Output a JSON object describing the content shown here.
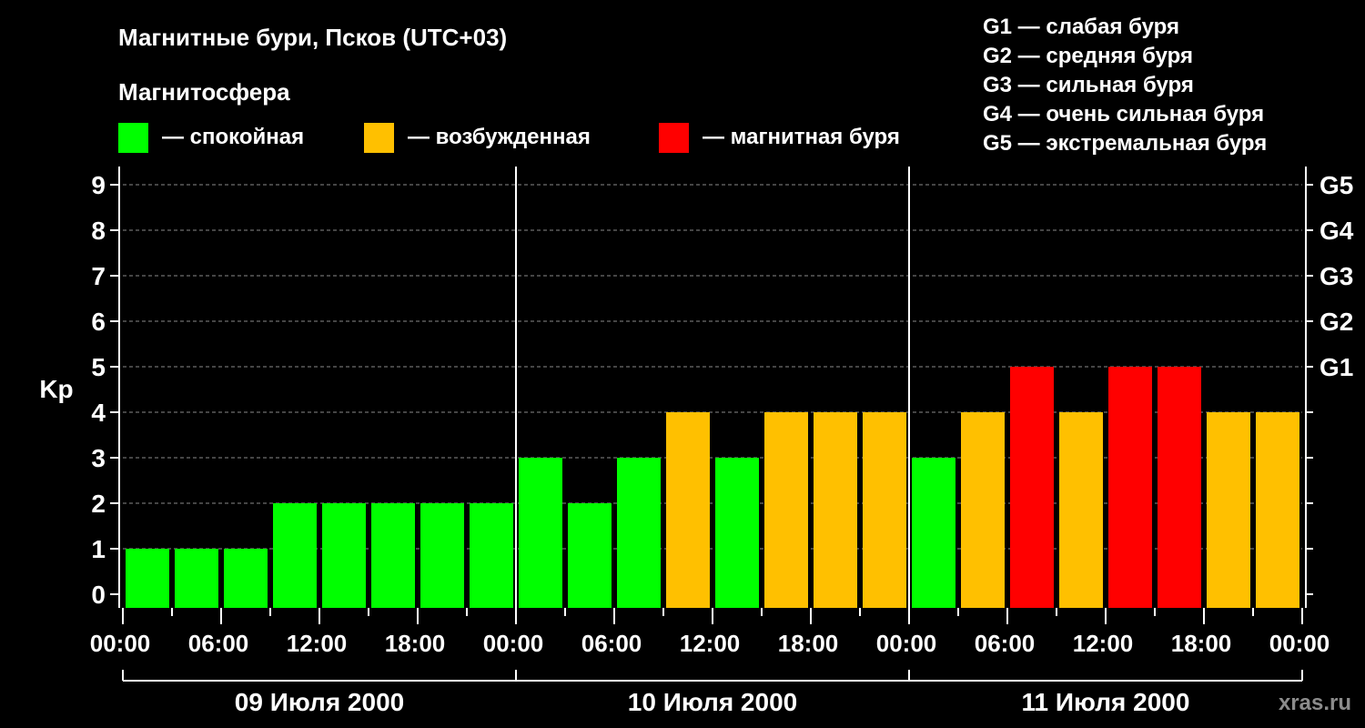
{
  "title": "Магнитные бури, Псков (UTC+03)",
  "subtitle": "Магнитосфера",
  "legend": [
    {
      "label": "— спокойная",
      "color": "#00ff00"
    },
    {
      "label": "— возбужденная",
      "color": "#ffc000"
    },
    {
      "label": "— магнитная буря",
      "color": "#ff0000"
    }
  ],
  "g_legend": [
    "G1 — слабая буря",
    "G2 — средняя буря",
    "G3 — сильная буря",
    "G4 — очень сильная буря",
    "G5 — экстремальная буря"
  ],
  "brand": "xras.ru",
  "chart_data": {
    "type": "bar",
    "ylabel": "Kp",
    "ylim": [
      0,
      9
    ],
    "y_ticks": [
      "0",
      "1",
      "2",
      "3",
      "4",
      "5",
      "6",
      "7",
      "8",
      "9"
    ],
    "g_ticks": [
      {
        "value": 5,
        "label": "G1"
      },
      {
        "value": 6,
        "label": "G2"
      },
      {
        "value": 7,
        "label": "G3"
      },
      {
        "value": 8,
        "label": "G4"
      },
      {
        "value": 9,
        "label": "G5"
      }
    ],
    "grid": true,
    "x_tick_labels": [
      "00:00",
      "06:00",
      "12:00",
      "18:00",
      "00:00",
      "06:00",
      "12:00",
      "18:00",
      "00:00",
      "06:00",
      "12:00",
      "18:00",
      "00:00"
    ],
    "days": [
      "09 Июля 2000",
      "10 Июля 2000",
      "11 Июля 2000"
    ],
    "values": [
      1,
      1,
      1,
      2,
      2,
      2,
      2,
      2,
      3,
      2,
      3,
      4,
      3,
      4,
      4,
      4,
      3,
      4,
      5,
      4,
      5,
      5,
      4,
      4
    ],
    "colors": [
      "#00ff00",
      "#00ff00",
      "#00ff00",
      "#00ff00",
      "#00ff00",
      "#00ff00",
      "#00ff00",
      "#00ff00",
      "#00ff00",
      "#00ff00",
      "#00ff00",
      "#ffc000",
      "#00ff00",
      "#ffc000",
      "#ffc000",
      "#ffc000",
      "#00ff00",
      "#ffc000",
      "#ff0000",
      "#ffc000",
      "#ff0000",
      "#ff0000",
      "#ffc000",
      "#ffc000"
    ]
  }
}
